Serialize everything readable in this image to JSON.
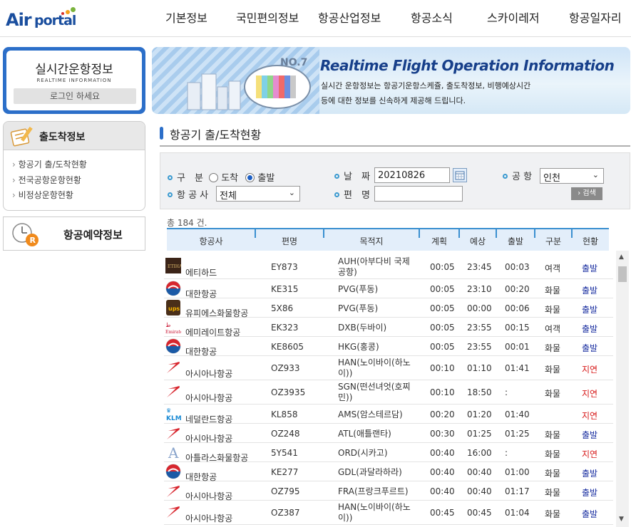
{
  "header": {
    "logo_air": "Air",
    "logo_portal": "portal",
    "nav": [
      "기본정보",
      "국민편의정보",
      "항공산업정보",
      "항공소식",
      "스카이레저",
      "항공일자리"
    ]
  },
  "sidebar": {
    "realtime_title": "실시간운항정보",
    "realtime_sub": "REALTIME INFORMATION",
    "login_label": "로그인 하세요",
    "menu_title": "출도착정보",
    "menu_items": [
      "항공기 출/도착현황",
      "전국공항운항현황",
      "비정상운항현황"
    ],
    "booking_title": "항공예약정보"
  },
  "banner": {
    "title": "Realtime Flight Operation Information",
    "desc_line1": "실시간 운항정보는 항공기운항스케쥴, 출도착정보, 비행예상시간",
    "desc_line2": "등에 대한 정보를 신속하게 제공해 드립니다."
  },
  "section_title": "항공기 출/도착현황",
  "search": {
    "type_label": "구　분",
    "type_options": [
      "도착",
      "출발"
    ],
    "type_selected": "출발",
    "date_label": "날　짜",
    "date_value": "20210826",
    "airport_label": "공 항",
    "airport_value": "인천",
    "airline_label": "항 공 사",
    "airline_value": "전체",
    "flight_label": "편　명",
    "flight_value": "",
    "search_button": "› 검색"
  },
  "total": "총 184 건.",
  "table": {
    "headers": [
      "항공사",
      "편명",
      "목적지",
      "계획",
      "예상",
      "출발",
      "구분",
      "현황"
    ],
    "rows": [
      {
        "logo": "etihad",
        "airline": "에티하드",
        "flight": "EY873",
        "dest1": "AUH(아부다비 국제",
        "dest2": "공항)",
        "plan": "00:05",
        "est": "23:45",
        "dep": "00:03",
        "type": "여객",
        "status": "출발"
      },
      {
        "logo": "korean-air",
        "airline": "대한항공",
        "flight": "KE315",
        "dest1": "PVG(푸동)",
        "dest2": "",
        "plan": "00:05",
        "est": "23:10",
        "dep": "00:20",
        "type": "화물",
        "status": "출발"
      },
      {
        "logo": "ups",
        "airline": "유피에스화물항공",
        "flight": "5X86",
        "dest1": "PVG(푸동)",
        "dest2": "",
        "plan": "00:05",
        "est": "00:00",
        "dep": "00:06",
        "type": "화물",
        "status": "출발"
      },
      {
        "logo": "emirates",
        "airline": "에미레이트항공",
        "flight": "EK323",
        "dest1": "DXB(두바이)",
        "dest2": "",
        "plan": "00:05",
        "est": "23:55",
        "dep": "00:15",
        "type": "여객",
        "status": "출발"
      },
      {
        "logo": "korean-air",
        "airline": "대한항공",
        "flight": "KE8605",
        "dest1": "HKG(홍콩)",
        "dest2": "",
        "plan": "00:05",
        "est": "23:55",
        "dep": "00:01",
        "type": "화물",
        "status": "출발"
      },
      {
        "logo": "asiana",
        "airline": "아시아나항공",
        "flight": "OZ933",
        "dest1": "HAN(노이바이(하노",
        "dest2": "이))",
        "plan": "00:10",
        "est": "01:10",
        "dep": "01:41",
        "type": "화물",
        "status": "지연"
      },
      {
        "logo": "asiana",
        "airline": "아시아나항공",
        "flight": "OZ3935",
        "dest1": "SGN(떤선녀엇(호찌",
        "dest2": "민))",
        "plan": "00:10",
        "est": "18:50",
        "dep": ":",
        "type": "화물",
        "status": "지연"
      },
      {
        "logo": "klm",
        "airline": "네덜란드항공",
        "flight": "KL858",
        "dest1": "AMS(암스테르담)",
        "dest2": "",
        "plan": "00:20",
        "est": "01:20",
        "dep": "01:40",
        "type": "",
        "status": "지연"
      },
      {
        "logo": "asiana",
        "airline": "아시아나항공",
        "flight": "OZ248",
        "dest1": "ATL(애틀랜타)",
        "dest2": "",
        "plan": "00:30",
        "est": "01:25",
        "dep": "01:25",
        "type": "화물",
        "status": "출발"
      },
      {
        "logo": "atlas",
        "airline": "아틀라스화물항공",
        "flight": "5Y541",
        "dest1": "ORD(시카고)",
        "dest2": "",
        "plan": "00:40",
        "est": "16:00",
        "dep": ":",
        "type": "화물",
        "status": "지연"
      },
      {
        "logo": "korean-air",
        "airline": "대한항공",
        "flight": "KE277",
        "dest1": "GDL(과달라하라)",
        "dest2": "",
        "plan": "00:40",
        "est": "00:40",
        "dep": "01:00",
        "type": "화물",
        "status": "출발"
      },
      {
        "logo": "asiana",
        "airline": "아시아나항공",
        "flight": "OZ795",
        "dest1": "FRA(프랑크푸르트)",
        "dest2": "",
        "plan": "00:40",
        "est": "00:40",
        "dep": "01:17",
        "type": "화물",
        "status": "출발"
      },
      {
        "logo": "asiana",
        "airline": "아시아나항공",
        "flight": "OZ387",
        "dest1": "HAN(노이바이(하노",
        "dest2": "이))",
        "plan": "00:45",
        "est": "00:45",
        "dep": "01:04",
        "type": "화물",
        "status": "출발"
      }
    ]
  },
  "colors": {
    "brand_blue": "#2c6fc9",
    "status_departed": "#1a2fa0",
    "status_delayed": "#d81b1b"
  }
}
